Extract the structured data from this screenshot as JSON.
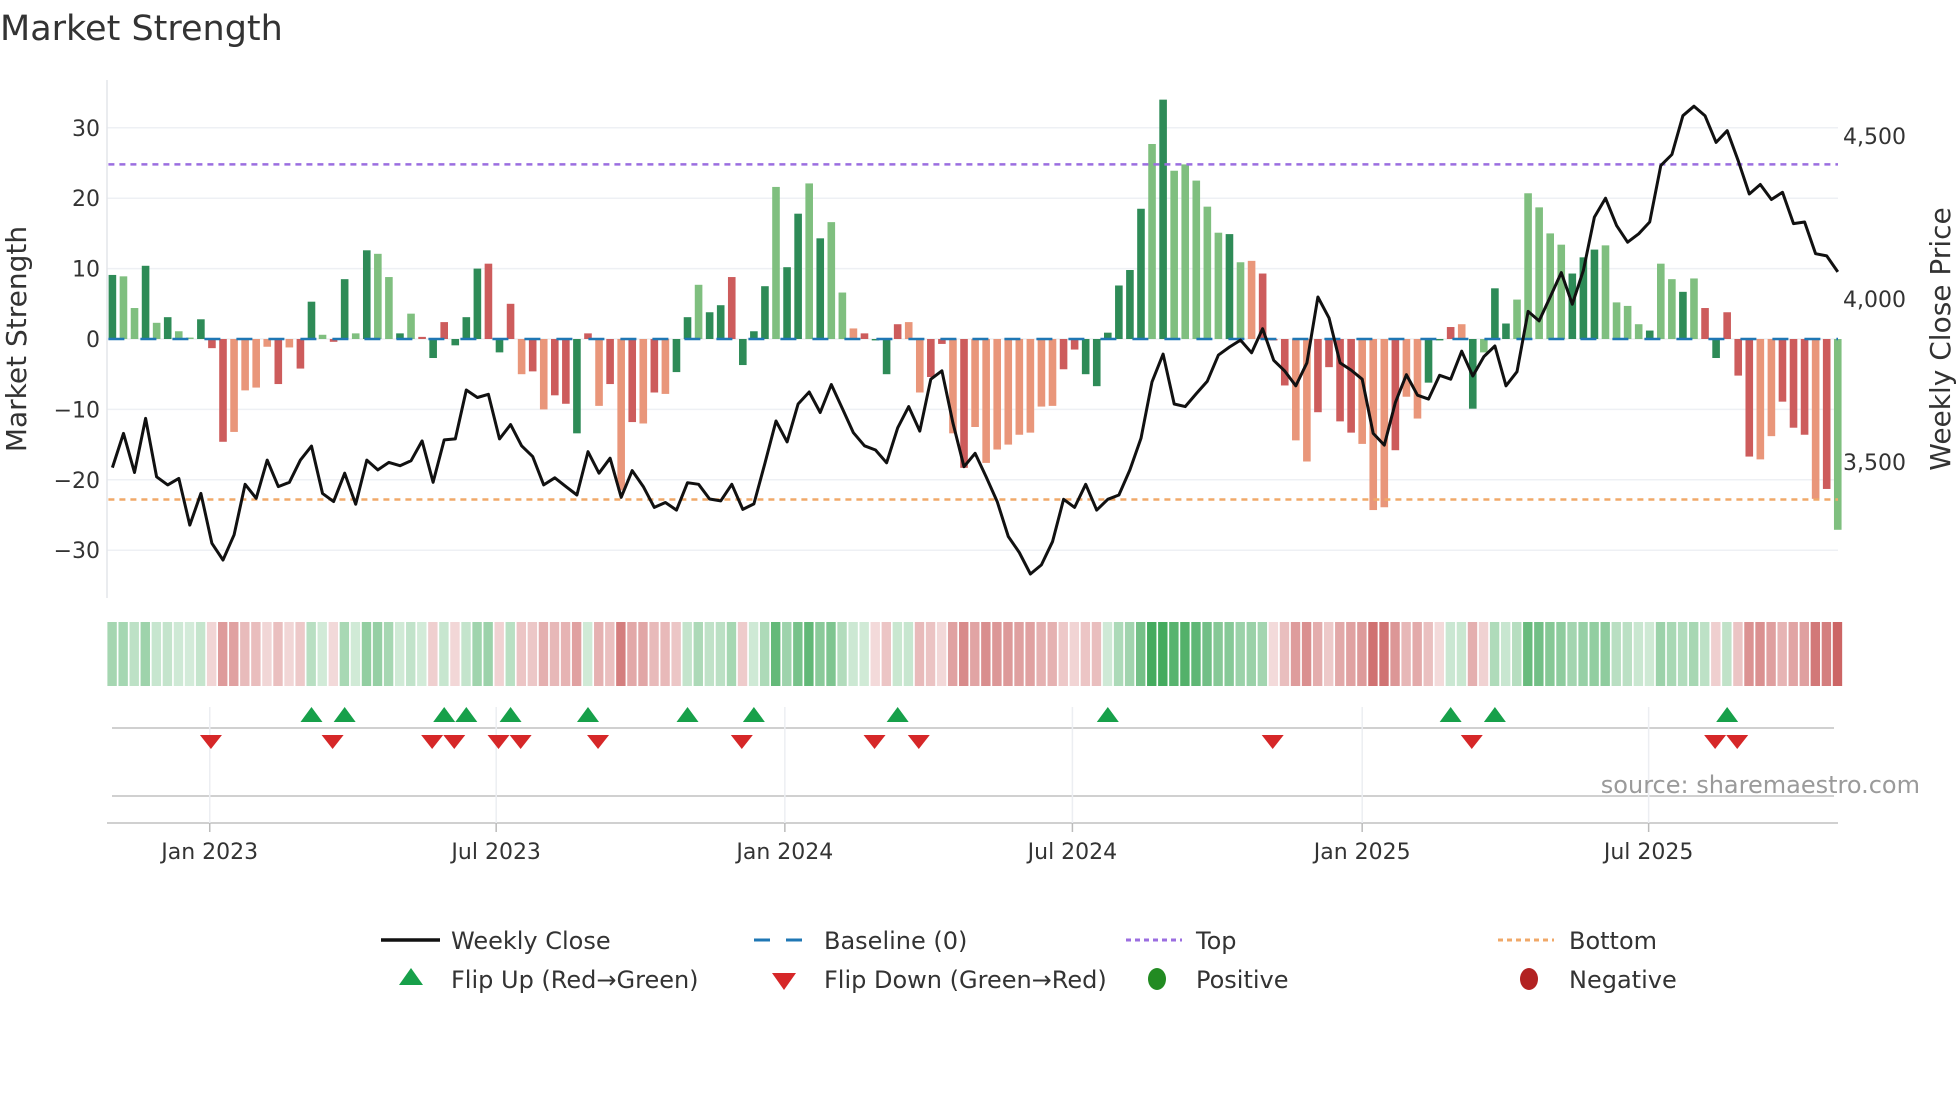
{
  "chart_data": {
    "type": "bar",
    "title": "Market Strength",
    "ylabel": "Market Strength",
    "y2label": "Weekly Close Price",
    "ylim": [
      -36,
      36
    ],
    "y2lim": [
      3070,
      4660
    ],
    "y_ticks": [
      -30,
      -20,
      -10,
      0,
      10,
      20,
      30
    ],
    "y_tick_labels": [
      "−30",
      "−20",
      "−10",
      "0",
      "10",
      "20",
      "30"
    ],
    "y2_ticks": [
      3500,
      4000,
      4500
    ],
    "y2_tick_labels": [
      "3,500",
      "4,000",
      "4,500"
    ],
    "x_unit": "week index",
    "x_ticks": [
      {
        "label": "Jan 2023",
        "at": 8.8
      },
      {
        "label": "Jul 2023",
        "at": 34.7
      },
      {
        "label": "Jan 2024",
        "at": 60.8
      },
      {
        "label": "Jul 2024",
        "at": 86.8
      },
      {
        "label": "Jan 2025",
        "at": 113.0
      },
      {
        "label": "Jul 2025",
        "at": 138.9
      }
    ],
    "top_level": 24.8,
    "bottom_level": -22.8,
    "baseline": 0,
    "strength": [
      9.1,
      8.9,
      4.4,
      10.4,
      2.3,
      3.1,
      1.1,
      0.2,
      2.8,
      -1.3,
      -14.6,
      -13.2,
      -7.3,
      -6.9,
      -1.1,
      -6.4,
      -1.2,
      -4.2,
      5.3,
      0.6,
      -0.4,
      8.5,
      0.8,
      12.6,
      12.1,
      8.8,
      0.8,
      3.6,
      0.3,
      -2.7,
      2.4,
      -0.9,
      3.1,
      10.0,
      10.7,
      -1.9,
      5.0,
      -5.0,
      -4.6,
      -10.0,
      -8.0,
      -9.2,
      -13.4,
      0.8,
      -9.5,
      -6.4,
      -21.5,
      -11.8,
      -12.0,
      -7.6,
      -7.8,
      -4.7,
      3.1,
      7.7,
      3.8,
      4.8,
      8.8,
      -3.7,
      1.1,
      7.5,
      21.6,
      10.2,
      17.8,
      22.1,
      14.3,
      16.6,
      6.6,
      1.5,
      0.8,
      -0.2,
      -5.0,
      2.1,
      2.4,
      -7.6,
      -5.4,
      -0.7,
      -13.4,
      -18.3,
      -12.5,
      -17.6,
      -15.7,
      -15.0,
      -13.6,
      -13.3,
      -9.6,
      -9.5,
      -4.3,
      -1.5,
      -5.0,
      -6.7,
      0.9,
      7.6,
      9.8,
      18.5,
      27.7,
      34.0,
      23.9,
      24.8,
      22.5,
      18.8,
      15.1,
      14.9,
      10.9,
      11.1,
      9.3,
      -0.2,
      -6.6,
      -14.4,
      -17.4,
      -10.4,
      -4.0,
      -11.7,
      -13.3,
      -14.9,
      -24.3,
      -23.9,
      -15.8,
      -8.2,
      -11.3,
      -6.2,
      -0.2,
      1.7,
      2.1,
      -9.9,
      -1.9,
      7.2,
      2.2,
      5.6,
      20.7,
      18.7,
      15.0,
      13.4,
      9.3,
      11.6,
      12.7,
      13.3,
      5.2,
      4.7,
      2.1,
      1.2,
      10.7,
      8.5,
      6.7,
      8.6,
      4.4,
      -2.7,
      3.8,
      -5.2,
      -16.7,
      -17.1,
      -13.8,
      -8.9,
      -12.6,
      -13.6,
      -22.7,
      -21.3,
      -27.1
    ],
    "strength_shade": "GggGgGggGRRrrrrRrRGgRGgGggGgRGRGGGRGRrRrRRGRrRrRrRrGGgGGRGGGgGGgGggrRGGRrrRRrRrrrrrrrrRRGGGGGGgGgggggGgrRRRrrRRRRrrrRrrGGRrGgGGgggggGGGggggGggGgRGRRRrrRRRrR",
    "weekly_close": [
      3483,
      3588,
      3468,
      3634,
      3455,
      3430,
      3450,
      3307,
      3404,
      3251,
      3200,
      3277,
      3432,
      3389,
      3506,
      3425,
      3438,
      3506,
      3549,
      3404,
      3379,
      3466,
      3371,
      3506,
      3476,
      3499,
      3489,
      3504,
      3565,
      3438,
      3568,
      3571,
      3721,
      3698,
      3708,
      3571,
      3615,
      3550,
      3517,
      3430,
      3452,
      3425,
      3399,
      3532,
      3466,
      3512,
      3392,
      3474,
      3425,
      3361,
      3376,
      3353,
      3437,
      3432,
      3387,
      3381,
      3432,
      3355,
      3372,
      3496,
      3626,
      3562,
      3678,
      3715,
      3652,
      3738,
      3664,
      3590,
      3550,
      3537,
      3498,
      3605,
      3670,
      3595,
      3754,
      3780,
      3619,
      3486,
      3527,
      3455,
      3379,
      3272,
      3223,
      3157,
      3185,
      3256,
      3386,
      3361,
      3432,
      3353,
      3386,
      3399,
      3476,
      3573,
      3746,
      3831,
      3678,
      3670,
      3710,
      3748,
      3828,
      3853,
      3874,
      3835,
      3909,
      3812,
      3779,
      3734,
      3804,
      4006,
      3942,
      3804,
      3782,
      3754,
      3588,
      3552,
      3683,
      3768,
      3705,
      3693,
      3766,
      3754,
      3840,
      3764,
      3823,
      3856,
      3734,
      3777,
      3962,
      3933,
      4006,
      4081,
      3984,
      4088,
      4251,
      4309,
      4225,
      4174,
      4200,
      4236,
      4409,
      4443,
      4562,
      4591,
      4562,
      4480,
      4516,
      4424,
      4322,
      4351,
      4305,
      4327,
      4231,
      4236,
      4139,
      4132,
      4083
    ],
    "flip_up": [
      18,
      21,
      30,
      32,
      36,
      43,
      52,
      58,
      71,
      90,
      121,
      125,
      146
    ],
    "flip_down": [
      9,
      20,
      29,
      31,
      35,
      37,
      44,
      57,
      69,
      73,
      105,
      123,
      145,
      147
    ],
    "legend": {
      "weekly_close": "Weekly Close",
      "baseline": "Baseline (0)",
      "top": "Top",
      "bottom": "Bottom",
      "flip_up": "Flip Up (Red→Green)",
      "flip_down": "Flip Down (Green→Red)",
      "positive": "Positive",
      "negative": "Negative"
    },
    "legend_placement": "bottom",
    "source": "source: sharemaestro.com",
    "colors": {
      "strong_pos": "#2e8b57",
      "weak_pos": "#7fbf7f",
      "strong_neg": "#cd5c5c",
      "weak_neg": "#e9967a",
      "line": "#111111",
      "baseline": "#1f77b4",
      "top": "#9b6ee0",
      "bottom": "#f0a868",
      "flip_up": "#17a04a",
      "flip_down": "#d62728",
      "positive": "#228b22",
      "negative": "#b22222"
    }
  }
}
